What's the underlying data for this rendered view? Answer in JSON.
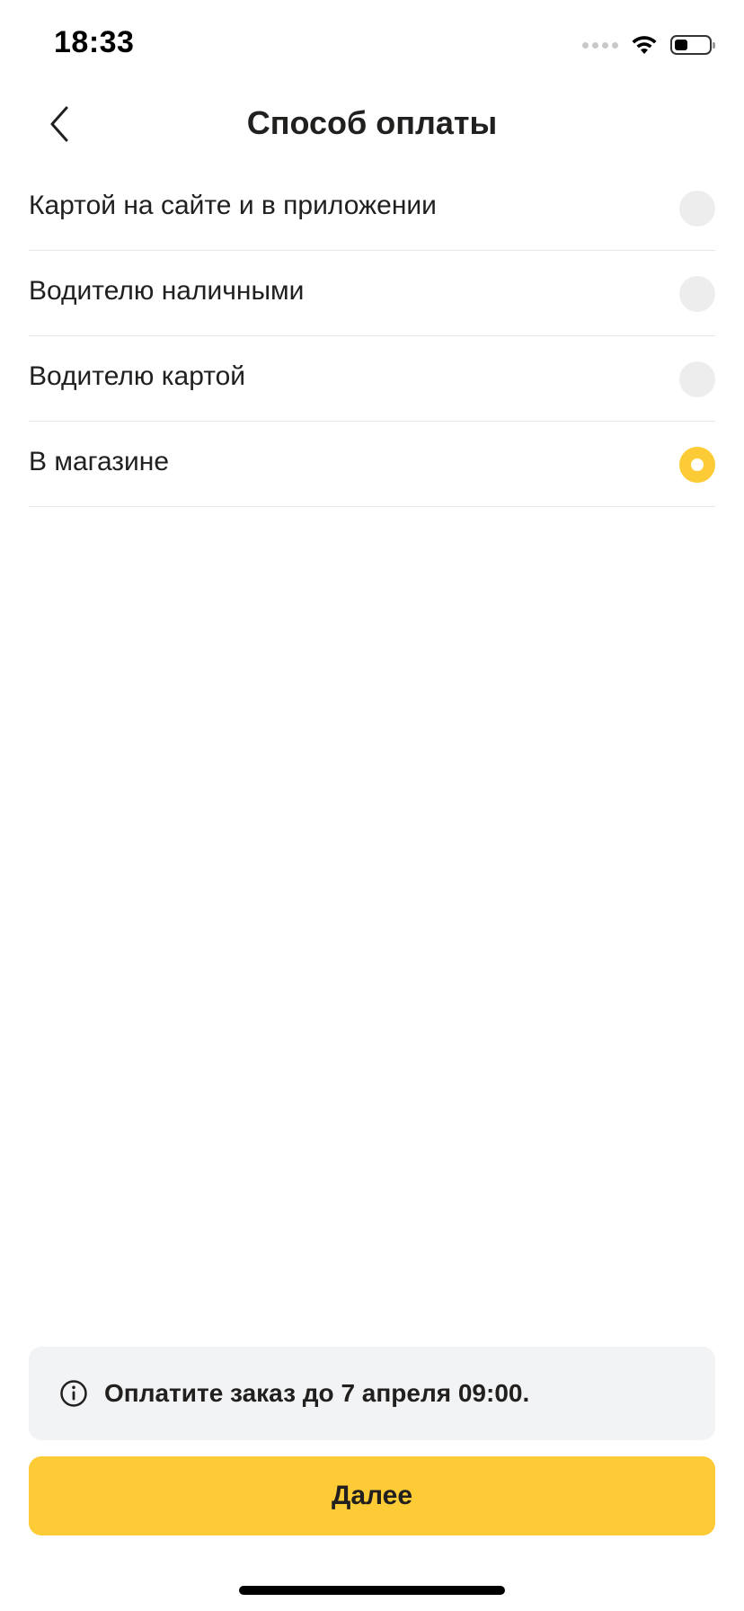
{
  "status_bar": {
    "time": "18:33",
    "icons": [
      "signal-dots-icon",
      "wifi-icon",
      "battery-icon"
    ]
  },
  "header": {
    "title": "Способ оплаты",
    "back_icon": "chevron-left-icon"
  },
  "payment_options": [
    {
      "label": "Картой на сайте и в приложении",
      "selected": false
    },
    {
      "label": "Водителю наличными",
      "selected": false
    },
    {
      "label": "Водителю картой",
      "selected": false
    },
    {
      "label": "В магазине",
      "selected": true
    }
  ],
  "info_banner": {
    "icon": "info-icon",
    "text": "Оплатите заказ до 7 апреля 09:00."
  },
  "footer": {
    "next_label": "Далее"
  },
  "colors": {
    "accent": "#fccb35",
    "text": "#21201f",
    "radio_unselected": "#ededed",
    "banner_bg": "#f2f3f5",
    "divider": "#e6e6e6"
  }
}
